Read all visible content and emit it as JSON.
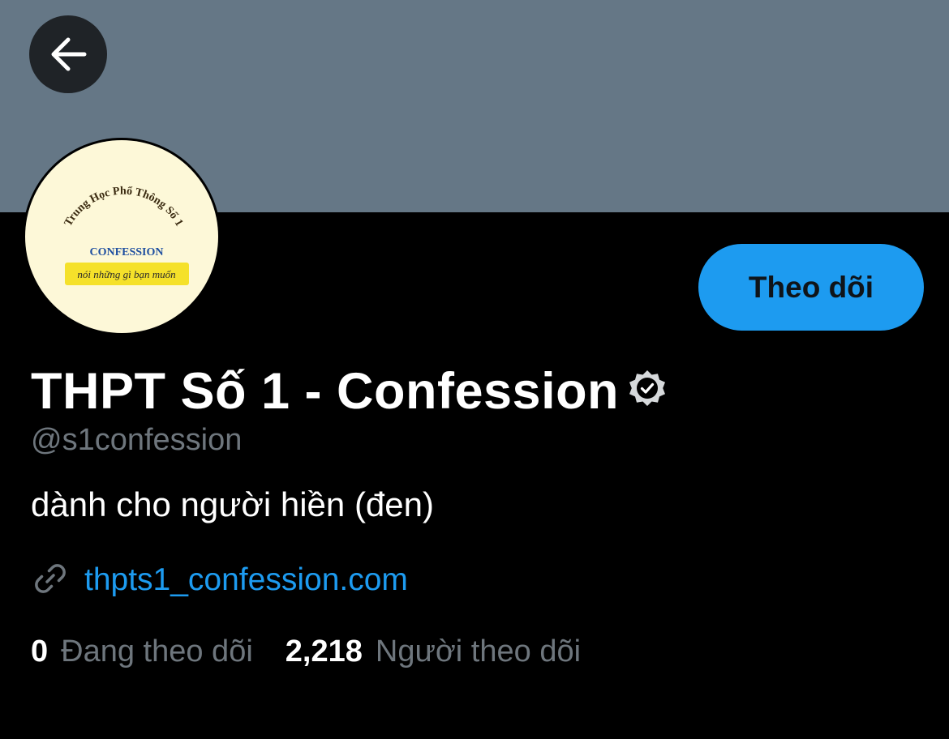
{
  "header": {
    "back_icon": "arrow-left-icon",
    "banner_color": "#657786"
  },
  "avatar": {
    "arc_text": "Trung Học Phổ Thông Số 1",
    "title": "CONFESSION",
    "tagline": "nói những gì bạn muốn",
    "title_color": "#1f4fa0",
    "tagline_bg": "#f5e12a"
  },
  "actions": {
    "follow_label": "Theo dõi",
    "follow_color": "#1d9bf0"
  },
  "profile": {
    "display_name": "THPT Số 1 - Confession",
    "verified_icon": "verified-badge-icon",
    "handle": "@s1confession",
    "bio": "dành cho người hiền (đen)",
    "link_icon": "link-icon",
    "website": "thpts1_confession.com"
  },
  "stats": {
    "following_count": "0",
    "following_label": "Đang theo dõi",
    "followers_count": "2,218",
    "followers_label": "Người theo dõi"
  }
}
